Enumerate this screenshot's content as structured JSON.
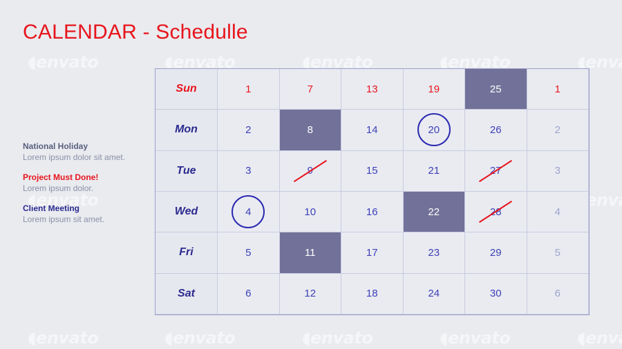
{
  "title": "CALENDAR - Schedulle",
  "legend": [
    {
      "title": "National Holiday",
      "description": "Lorem ipsum dolor sit amet.",
      "color": "#5a5f7e"
    },
    {
      "title": "Project Must Done!",
      "description": "Lorem ipsum dolor.",
      "color": "#e8141c"
    },
    {
      "title": "Client Meeting",
      "description": "Lorem ipsum sit amet.",
      "color": "#2b2a8f"
    }
  ],
  "watermark_text": "envato",
  "calendar": {
    "rows": [
      {
        "day": "Sun",
        "dates": [
          "1",
          "7",
          "13",
          "19",
          "25",
          "1"
        ]
      },
      {
        "day": "Mon",
        "dates": [
          "2",
          "8",
          "14",
          "20",
          "26",
          "2"
        ]
      },
      {
        "day": "Tue",
        "dates": [
          "3",
          "9",
          "15",
          "21",
          "27",
          "3"
        ]
      },
      {
        "day": "Wed",
        "dates": [
          "4",
          "10",
          "16",
          "22",
          "28",
          "4"
        ]
      },
      {
        "day": "Fri",
        "dates": [
          "5",
          "11",
          "17",
          "23",
          "29",
          "5"
        ]
      },
      {
        "day": "Sat",
        "dates": [
          "6",
          "12",
          "18",
          "24",
          "30",
          "6"
        ]
      }
    ],
    "highlighted_dates": [
      "25",
      "8",
      "22",
      "11"
    ],
    "circled_dates": [
      "20",
      "4"
    ],
    "struck_dates": [
      "9",
      "27",
      "28"
    ]
  },
  "colors": {
    "accent_red": "#e8141c",
    "accent_blue": "#2b2a8f",
    "highlight_fill": "#727199"
  }
}
